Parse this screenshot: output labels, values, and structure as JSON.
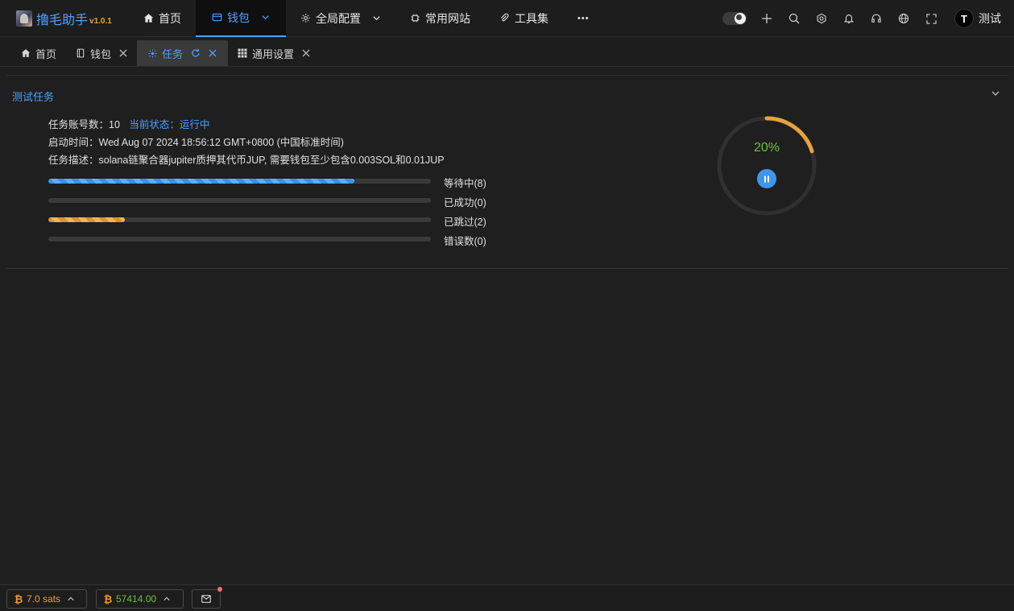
{
  "app": {
    "title": "撸毛助手",
    "version": "v1.0.1"
  },
  "nav": {
    "items": [
      {
        "label": "首页",
        "icon": "home-icon"
      },
      {
        "label": "钱包",
        "icon": "wallet-icon",
        "active": true,
        "has_dropdown": true
      },
      {
        "label": "全局配置",
        "icon": "gear-icon",
        "has_dropdown": true
      },
      {
        "label": "常用网站",
        "icon": "chip-icon"
      },
      {
        "label": "工具集",
        "icon": "paperclip-icon"
      }
    ],
    "more": "•••"
  },
  "user": {
    "avatar_letter": "T",
    "name": "测试"
  },
  "tabs": [
    {
      "label": "首页",
      "icon": "home-icon",
      "closable": false
    },
    {
      "label": "钱包",
      "icon": "notebook-icon",
      "closable": true
    },
    {
      "label": "任务",
      "icon": "sun-icon",
      "closable": true,
      "active": true
    },
    {
      "label": "通用设置",
      "icon": "grid-icon",
      "closable": true
    }
  ],
  "task": {
    "title": "测试任务",
    "account_count_label": "任务账号数：",
    "account_count": "10",
    "status_text": "当前状态：运行中",
    "start_time": "启动时间：Wed Aug 07 2024 18:56:12 GMT+0800 (中国标准时间)",
    "description": "任务描述：solana链聚合器jupiter质押其代币JUP, 需要钱包至少包含0.003SOL和0.01JUP",
    "progress_bars": [
      {
        "label": "等待中(8)",
        "fraction": 0.8,
        "color": "#4da1ff"
      },
      {
        "label": "已成功(0)",
        "fraction": 0.0,
        "color": "#67c23a"
      },
      {
        "label": "已跳过(2)",
        "fraction": 0.2,
        "color": "#e6a23c"
      },
      {
        "label": "错误数(0)",
        "fraction": 0.0,
        "color": "#f56c6c"
      }
    ],
    "overall_percent_text": "20%",
    "overall_fraction": 0.2
  },
  "footer": {
    "sats": "7.0 sats",
    "btc_price": "57414.00"
  },
  "colors": {
    "accent": "#4da1ff",
    "warning": "#e6a23c",
    "success": "#67c23a",
    "danger": "#f56c6c"
  }
}
